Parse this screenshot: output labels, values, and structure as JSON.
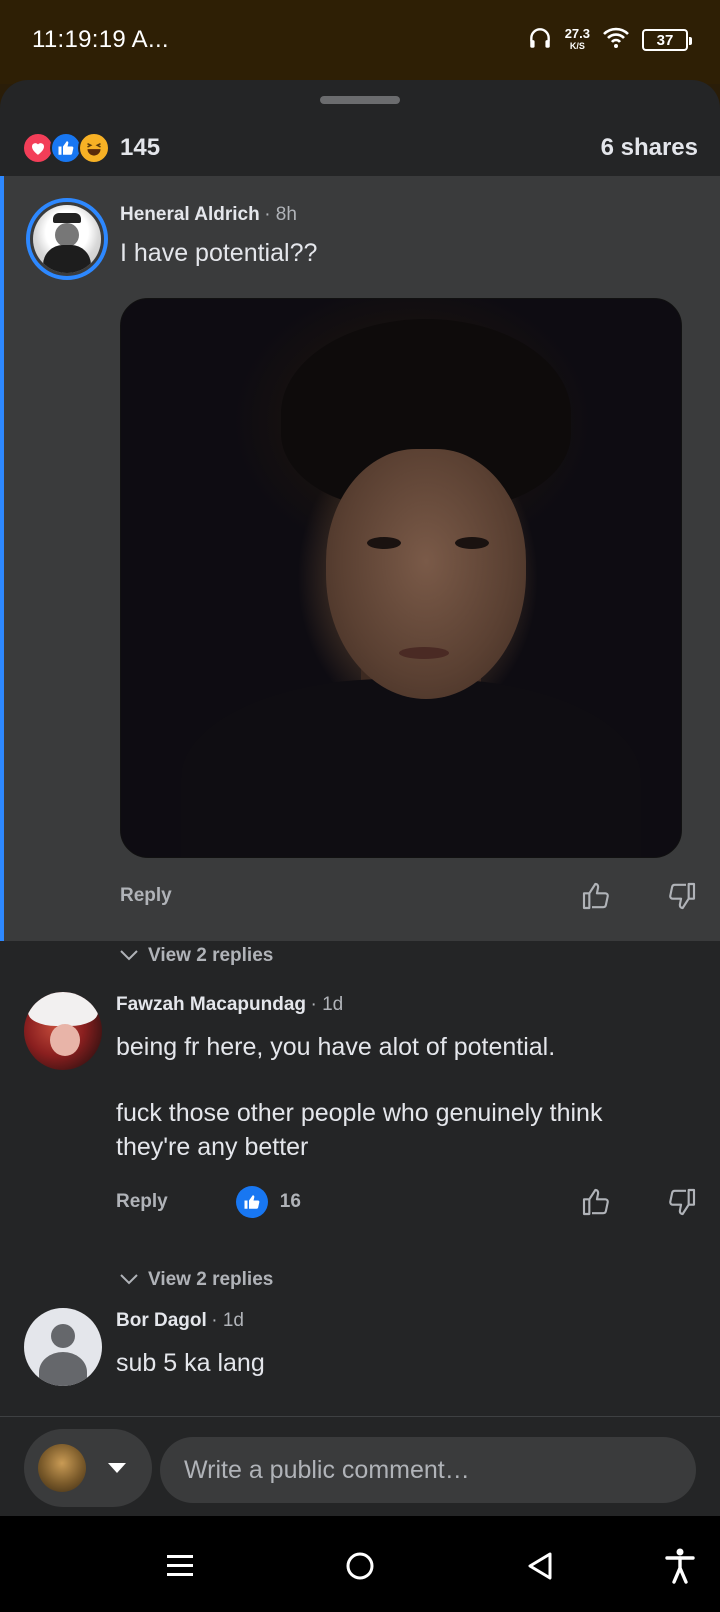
{
  "status_bar": {
    "time": "11:19:19 A...",
    "net_speed": "27.3",
    "net_unit": "K/S",
    "battery": "37"
  },
  "post": {
    "reaction_count": "145",
    "shares": "6 shares",
    "reactions": [
      "love-icon",
      "like-icon",
      "haha-icon"
    ]
  },
  "comments": [
    {
      "name": "Heneral Aldrich",
      "time": "· 8h",
      "text": "I have potential??",
      "has_photo": true,
      "reply_label": "Reply",
      "view_replies": "View 2 replies",
      "highlighted": true
    },
    {
      "name": "Fawzah Macapundag",
      "time": "· 1d",
      "text_lines": [
        "being fr here, you have alot of potential.",
        "",
        "fuck those other people who genuinely think",
        "they're any better"
      ],
      "reply_label": "Reply",
      "like_count": "16",
      "view_replies": "View 2 replies"
    },
    {
      "name": "Bor Dagol",
      "time": "· 1d",
      "text": "sub 5 ka lang"
    }
  ],
  "composer": {
    "placeholder": "Write a public comment…"
  },
  "colors": {
    "accent": "#2d88ff",
    "like_blue": "#1877f2",
    "sheet_bg": "#242526",
    "highlight_bg": "#3a3b3c"
  }
}
